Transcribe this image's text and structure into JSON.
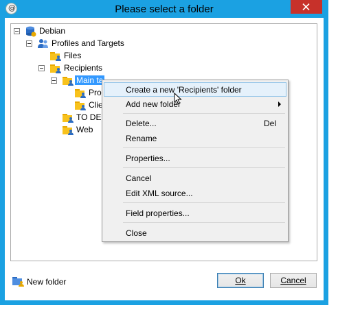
{
  "window": {
    "title": "Please select a folder",
    "accent_color": "#1ba1e2",
    "close_color": "#c7312a",
    "app_icon": "at-sign-icon"
  },
  "tree": {
    "root": {
      "label": "Debian",
      "icon": "database-icon"
    },
    "profiles": {
      "label": "Profiles and Targets",
      "icon": "people-icon"
    },
    "files": {
      "label": "Files",
      "icon": "folder-person-icon"
    },
    "recipients": {
      "label": "Recipients",
      "icon": "folder-person-icon"
    },
    "main": {
      "label": "Main ta",
      "icon": "folder-person-icon",
      "selected": true
    },
    "child1": {
      "label": "Proc",
      "icon": "folder-person-icon"
    },
    "child2": {
      "label": "Clie",
      "icon": "folder-person-icon"
    },
    "todel": {
      "label": "TO DEL",
      "icon": "folder-person-icon"
    },
    "web": {
      "label": "Web",
      "icon": "folder-person-icon"
    }
  },
  "context_menu": {
    "create": "Create a new 'Recipients' folder",
    "add_new_folder": "Add new folder",
    "delete": "Delete...",
    "delete_shortcut": "Del",
    "rename": "Rename",
    "properties": "Properties...",
    "cancel": "Cancel",
    "edit_xml": "Edit XML source...",
    "field_properties": "Field properties...",
    "close": "Close"
  },
  "footer": {
    "new_folder": "New folder",
    "ok": "Ok",
    "cancel": "Cancel"
  }
}
